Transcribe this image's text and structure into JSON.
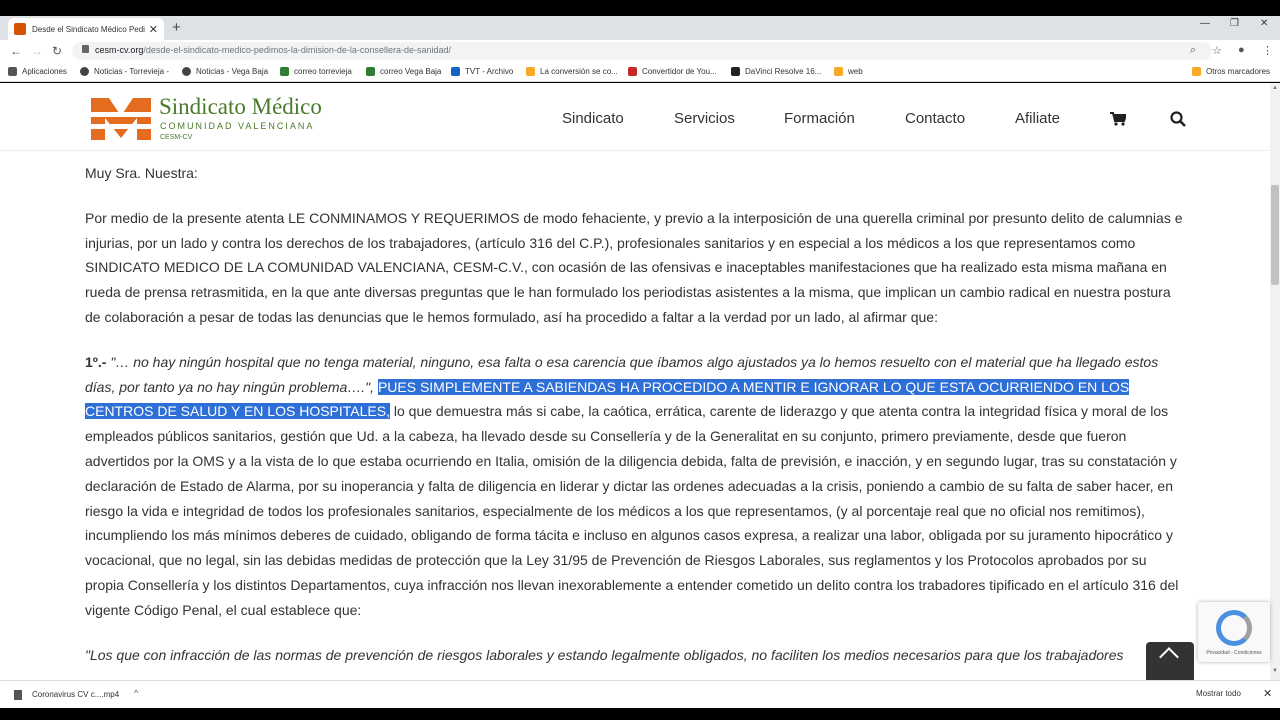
{
  "browser": {
    "tab_title": "Desde el Sindicato Médico Pedim...",
    "url_host": "cesm-cv.org",
    "url_path": "/desde-el-sindicato-medico-pedimos-la-dimision-de-la-consellera-de-sanidad/",
    "bookmarks": [
      {
        "label": "Aplicaciones",
        "color": "#555555"
      },
      {
        "label": "Noticias - Torrevieja -",
        "color": "#444444"
      },
      {
        "label": "Noticias - Vega Baja",
        "color": "#444444"
      },
      {
        "label": "correo torrevieja",
        "color": "#2e7d32"
      },
      {
        "label": "correo Vega Baja",
        "color": "#2e7d32"
      },
      {
        "label": "TVT - Archivo",
        "color": "#1565c0"
      },
      {
        "label": "La conversión se co...",
        "color": "#f9a825"
      },
      {
        "label": "Convertidor de You...",
        "color": "#c62828"
      },
      {
        "label": "DaVinci Resolve 16...",
        "color": "#222222"
      },
      {
        "label": "web",
        "color": "#f9a825"
      }
    ],
    "other_bookmarks": "Otros marcadores"
  },
  "site": {
    "logo_name": "Sindicato Médico",
    "logo_sub": "COMUNIDAD VALENCIANA",
    "logo_cesm": "CESM-CV",
    "menu": [
      "Sindicato",
      "Servicios",
      "Formación",
      "Contacto",
      "Afiliate"
    ]
  },
  "article": {
    "salutation": "Muy Sra. Nuestra:",
    "para1": "Por medio de la presente atenta LE CONMINAMOS Y REQUERIMOS de modo fehaciente, y previo a la interposición de una querella criminal por presunto delito de calumnias e injurias, por un lado y contra los derechos de los trabajadores, (artículo 316 del C.P.), profesionales sanitarios y en especial a los médicos a los que representamos como SINDICATO MEDICO DE LA COMUNIDAD VALENCIANA, CESM-C.V., con ocasión de las ofensivas e inaceptables manifestaciones que ha realizado esta misma mañana en rueda de prensa retrasmitida, en la que ante diversas preguntas que le han formulado los periodistas asistentes a la misma, que implican un cambio radical en nuestra postura de colaboración a pesar de todas las denuncias que le hemos formulado, así ha procedido a faltar a la verdad por un lado, al afirmar que:",
    "p2_num": "1º.-",
    "p2_quote": " \"… no hay ningún hospital que no tenga material, ninguno, esa falta o esa carencia que íbamos algo ajustados ya lo hemos resuelto con el material que ha llegado estos días, por tanto ya no hay ningún problema….\",",
    "p2_highlight": "PUES SIMPLEMENTE A SABIENDAS HA PROCEDIDO A  MENTIR E IGNORAR LO QUE ESTA OCURRIENDO EN LOS CENTROS DE SALUD Y EN LOS HOSPITALES,",
    "p2_rest": " lo que demuestra más si cabe, la caótica, errática, carente de liderazgo y que atenta contra la integridad física y moral de los empleados públicos sanitarios, gestión que Ud. a la cabeza, ha llevado desde su Consellería y de la Generalitat en su conjunto, primero previamente, desde que fueron advertidos por la OMS y a la vista de lo que estaba ocurriendo en Italia, omisión de la diligencia debida, falta de previsión, e inacción, y en segundo lugar, tras su constatación y declaración de Estado de Alarma, por su inoperancia y falta de diligencia en liderar y dictar las ordenes adecuadas a la crisis, poniendo a cambio de su falta de saber hacer, en riesgo la vida e integridad de todos los profesionales sanitarios, especialmente de los médicos a los que representamos, (y al porcentaje real que no oficial nos remitimos), incumpliendo los más mínimos deberes de cuidado, obligando de forma tácita e incluso en algunos casos expresa, a realizar una labor, obligada por su juramento hipocrático y vocacional, que no legal, sin las debidas medidas de protección que la Ley 31/95 de Prevención de Riesgos Laborales, sus reglamentos y los Protocolos aprobados por su propia Consellería y los distintos Departamentos, cuya infracción nos llevan inexorablemente a entender cometido un delito contra los trabadores tipificado en el artículo 316 del vigente Código Penal, el cual establece que:",
    "p3_partial": "\"Los que con infracción de las normas de prevención de riesgos laborales y estando legalmente obligados, no faciliten los medios necesarios para que los trabajadores"
  },
  "recaptcha": "Privacidad - Condiciones",
  "downloads": {
    "file": "Coronavirus CV c....mp4",
    "show_all": "Mostrar todo"
  }
}
